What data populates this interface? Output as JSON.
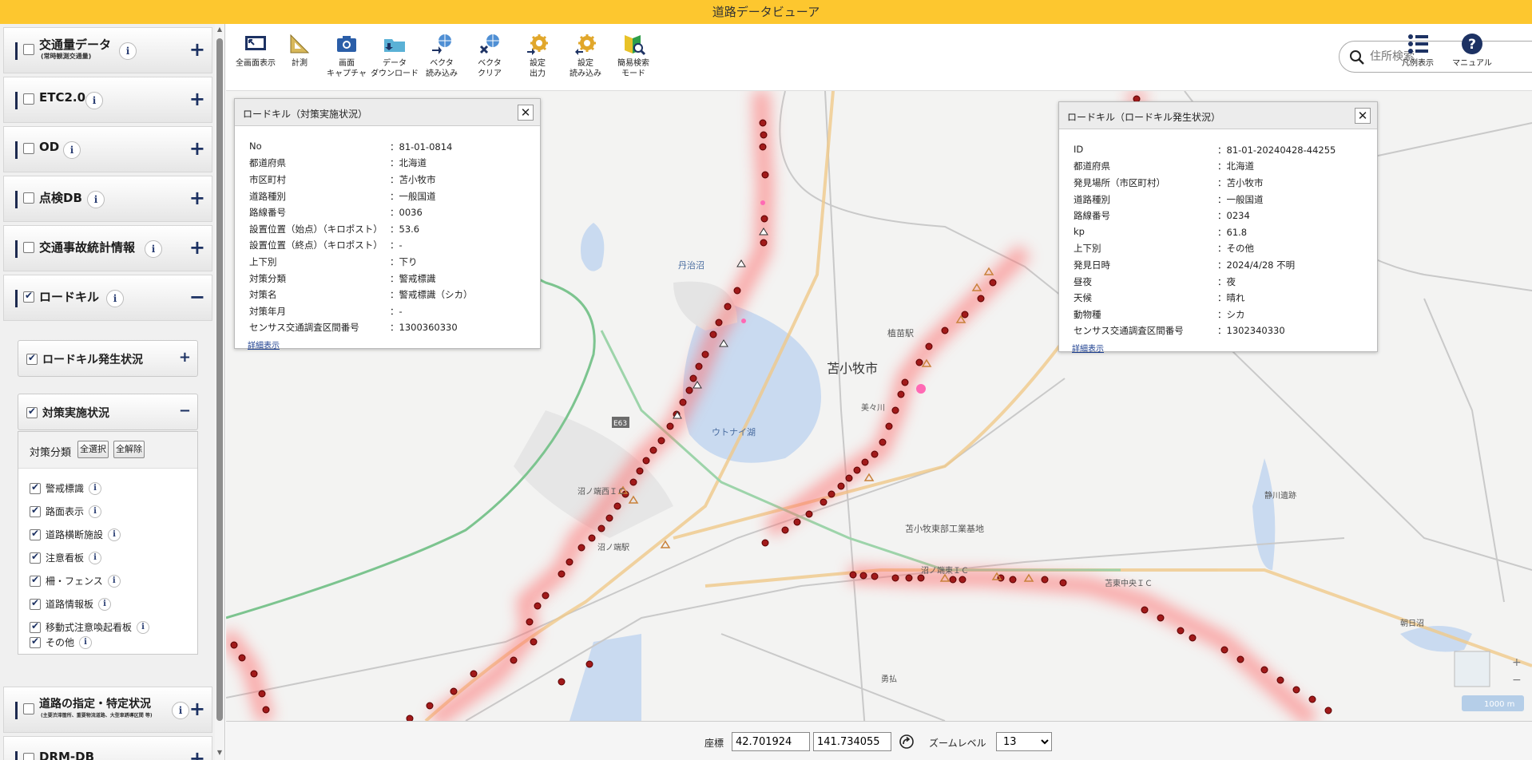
{
  "app": {
    "title": "道路データビューア"
  },
  "sidebar": {
    "sections": [
      {
        "label": "交通量データ",
        "sub": "(常時観測交通量)",
        "checked": false,
        "expanded": false
      },
      {
        "label": "ETC2.0",
        "checked": false,
        "expanded": false
      },
      {
        "label": "OD",
        "checked": false,
        "expanded": false
      },
      {
        "label": "点検DB",
        "checked": false,
        "expanded": false
      },
      {
        "label": "交通事故統計情報",
        "checked": false,
        "expanded": false
      },
      {
        "label": "ロードキル",
        "checked": true,
        "expanded": true
      },
      {
        "label": "道路の指定・特定状況",
        "sub": "(主要渋滞箇所、重要物流道路、大型車誘導区間 等)",
        "checked": false,
        "expanded": false
      },
      {
        "label": "DRM-DB",
        "checked": false,
        "expanded": false
      }
    ],
    "roadkill_sub": [
      {
        "label": "ロードキル発生状況",
        "checked": true,
        "expanded": false
      },
      {
        "label": "対策実施状況",
        "checked": true,
        "expanded": true
      }
    ],
    "filter": {
      "title": "対策分類",
      "select_all": "全選択",
      "clear_all": "全解除",
      "options": [
        "警戒標識",
        "路面表示",
        "道路横断施設",
        "注意看板",
        "柵・フェンス",
        "道路情報板",
        "移動式注意喚起看板",
        "その他"
      ]
    }
  },
  "toolbar": {
    "buttons": [
      {
        "label1": "全画面表示",
        "label2": "",
        "icon": "fullscreen-icon"
      },
      {
        "label1": "計測",
        "label2": "",
        "icon": "ruler-icon"
      },
      {
        "label1": "画面",
        "label2": "キャプチャ",
        "icon": "camera-icon"
      },
      {
        "label1": "データ",
        "label2": "ダウンロード",
        "icon": "folder-download-icon"
      },
      {
        "label1": "ベクタ",
        "label2": "読み込み",
        "icon": "vector-load-icon"
      },
      {
        "label1": "ベクタ",
        "label2": "クリア",
        "icon": "vector-clear-icon"
      },
      {
        "label1": "設定",
        "label2": "出力",
        "icon": "settings-export-icon"
      },
      {
        "label1": "設定",
        "label2": "読み込み",
        "icon": "settings-import-icon"
      },
      {
        "label1": "簡易検索",
        "label2": "モード",
        "icon": "search-mode-icon"
      }
    ],
    "search_placeholder": "住所検索",
    "legend_label": "凡例表示",
    "manual_label": "マニュアル"
  },
  "popup_measures": {
    "title": "ロードキル（対策実施状況）",
    "rows": [
      [
        "No",
        "81-01-0814"
      ],
      [
        "都道府県",
        "北海道"
      ],
      [
        "市区町村",
        "苫小牧市"
      ],
      [
        "道路種別",
        "一般国道"
      ],
      [
        "路線番号",
        "0036"
      ],
      [
        "設置位置（始点）（キロポスト）",
        "53.6"
      ],
      [
        "設置位置（終点）（キロポスト）",
        "-"
      ],
      [
        "上下別",
        "下り"
      ],
      [
        "対策分類",
        "警戒標識"
      ],
      [
        "対策名",
        "警戒標識（シカ）"
      ],
      [
        "対策年月",
        "-"
      ],
      [
        "センサス交通調査区間番号",
        "1300360330"
      ]
    ],
    "detail_link": "詳細表示"
  },
  "popup_incidents": {
    "title": "ロードキル（ロードキル発生状況）",
    "rows": [
      [
        "ID",
        "81-01-20240428-44255"
      ],
      [
        "都道府県",
        "北海道"
      ],
      [
        "発見場所（市区町村）",
        "苫小牧市"
      ],
      [
        "道路種別",
        "一般国道"
      ],
      [
        "路線番号",
        "0234"
      ],
      [
        "kp",
        "61.8"
      ],
      [
        "上下別",
        "その他"
      ],
      [
        "発見日時",
        "2024/4/28 不明"
      ],
      [
        "昼夜",
        "夜"
      ],
      [
        "天候",
        "晴れ"
      ],
      [
        "動物種",
        "シカ"
      ],
      [
        "センサス交通調査区間番号",
        "1302340330"
      ]
    ],
    "detail_link": "詳細表示"
  },
  "map": {
    "labels": [
      "苫小牧市",
      "丹治沼",
      "ウトナイ湖",
      "植苗駅",
      "苫小牧東部工業基地",
      "沼ノ端東ＩＣ",
      "苫東中央ＩＣ",
      "沼ノ端西ＩＣ",
      "朝日沼",
      "静川遺跡",
      "美々川",
      "勇払",
      "E63",
      "沼ノ端駅"
    ],
    "scale": "1000 m",
    "colors": {
      "marker": "#a11a1a",
      "halo": "#ff6b6b",
      "triangle": "#c8813a",
      "water": "#c9daf0",
      "green_road": "#7cc48f"
    }
  },
  "status": {
    "coord_label": "座標",
    "lat": "42.701924",
    "lon": "141.734055",
    "zoom_label": "ズームレベル",
    "zoom": "13"
  }
}
